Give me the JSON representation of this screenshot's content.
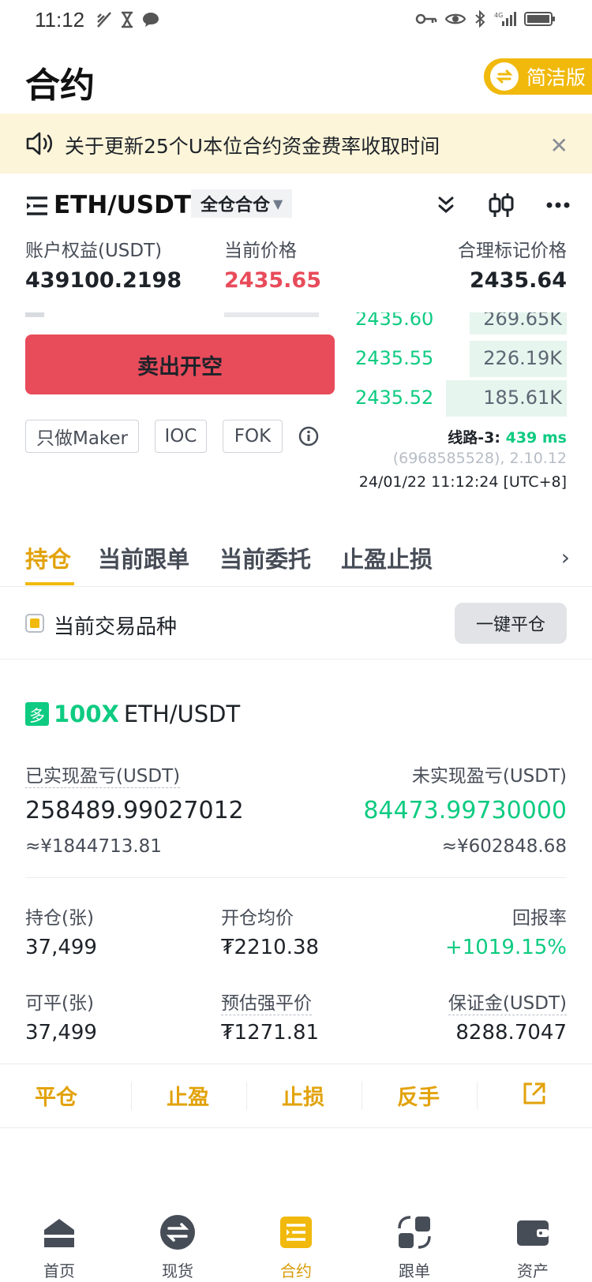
{
  "status": {
    "time": "11:12"
  },
  "header": {
    "title": "合约",
    "simple_mode_label": "简洁版"
  },
  "notice": {
    "text": "关于更新25个U本位合约资金费率收取时间"
  },
  "symbol": {
    "name": "ETH/USDT",
    "margin_mode": "全仓合仓"
  },
  "stats": {
    "equity_label": "账户权益(USDT)",
    "equity_value": "439100.2198",
    "price_label": "当前价格",
    "price_value": "2435.65",
    "mark_label": "合理标记价格",
    "mark_value": "2435.64"
  },
  "order": {
    "sell_label": "卖出开空"
  },
  "orderbook": [
    {
      "price": "2435.60",
      "qty": "269.65K",
      "depth": 0.46
    },
    {
      "price": "2435.55",
      "qty": "226.19K",
      "depth": 0.46
    },
    {
      "price": "2435.52",
      "qty": "185.61K",
      "depth": 0.57
    }
  ],
  "options": {
    "maker": "只做Maker",
    "ioc": "IOC",
    "fok": "FOK"
  },
  "meta": {
    "line_label": "线路-3:",
    "latency": "439 ms",
    "version": "(6968585528), 2.10.12",
    "timestamp": "24/01/22 11:12:24 [UTC+8]"
  },
  "tabs": [
    "持仓",
    "当前跟单",
    "当前委托",
    "止盈止损"
  ],
  "filter": {
    "label": "当前交易品种",
    "close_all": "一键平仓"
  },
  "position": {
    "side": "多",
    "leverage": "100X",
    "symbol": "ETH/USDT",
    "realized_label": "已实现盈亏(USDT)",
    "realized_value": "258489.99027012",
    "realized_cny": "≈¥1844713.81",
    "unrealized_label": "未实现盈亏(USDT)",
    "unrealized_value": "84473.99730000",
    "unrealized_cny": "≈¥602848.68",
    "size_label": "持仓(张)",
    "size_value": "37,499",
    "entry_label": "开仓均价",
    "entry_value": "₮2210.38",
    "roe_label": "回报率",
    "roe_value": "+1019.15%",
    "closable_label": "可平(张)",
    "closable_value": "37,499",
    "liq_label": "预估强平价",
    "liq_value": "₮1271.81",
    "margin_label": "保证金(USDT)",
    "margin_value": "8288.7047"
  },
  "actions": {
    "close": "平仓",
    "tp": "止盈",
    "sl": "止损",
    "reverse": "反手"
  },
  "nav": [
    {
      "label": "首页",
      "icon": "home-icon"
    },
    {
      "label": "现货",
      "icon": "spot-icon"
    },
    {
      "label": "合约",
      "icon": "futures-icon"
    },
    {
      "label": "跟单",
      "icon": "copy-trade-icon"
    },
    {
      "label": "资产",
      "icon": "wallet-icon"
    }
  ],
  "colors": {
    "accent": "#f0b90b",
    "buy": "#0ecb81",
    "sell": "#e84b5a",
    "price_red": "#e84b5a"
  }
}
